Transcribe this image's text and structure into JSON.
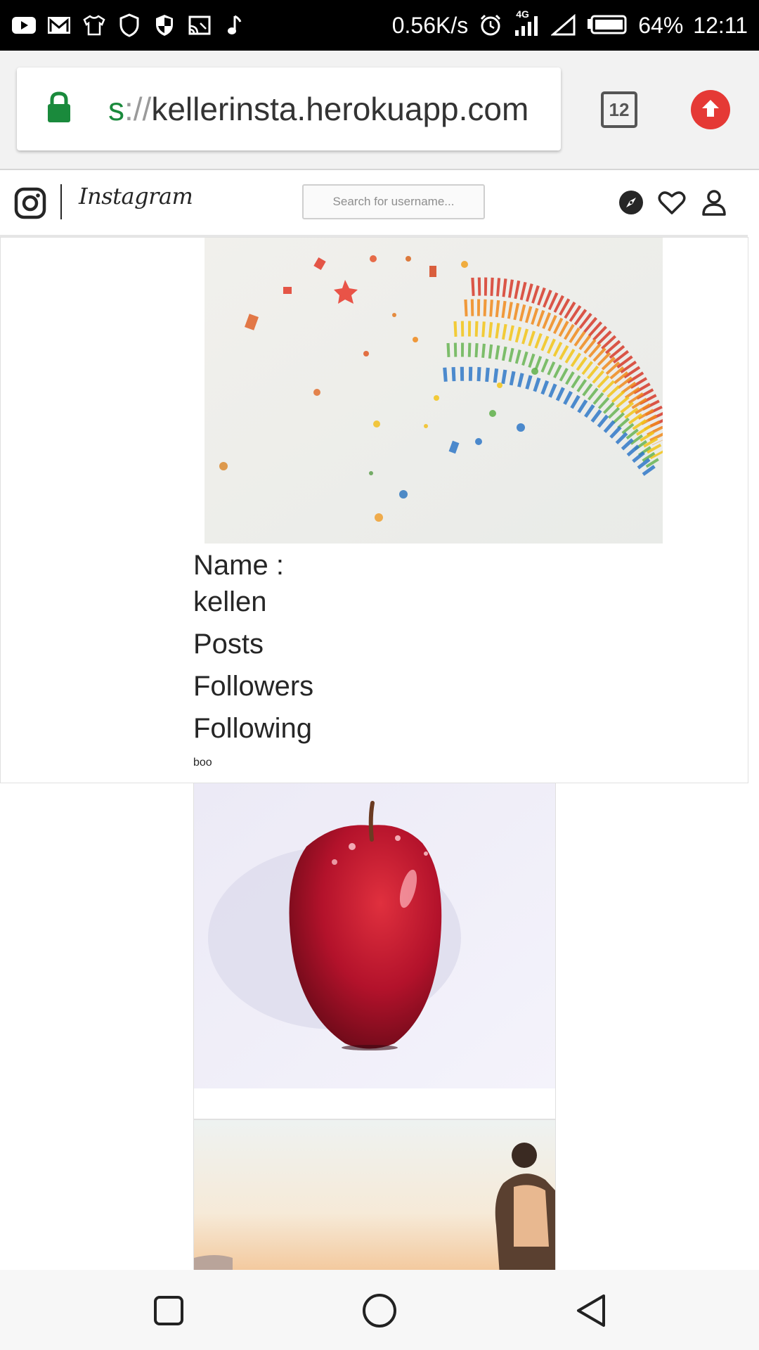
{
  "status_bar": {
    "network_speed": "0.56K/s",
    "network_type": "4G",
    "battery": "64%",
    "time": "12:11",
    "icons": [
      "youtube-icon",
      "gmail-icon",
      "shirt-icon",
      "shield-icon",
      "shield-half-icon",
      "cast-icon",
      "music-note-icon",
      "alarm-icon",
      "signal-icon",
      "signal-empty-icon",
      "battery-icon"
    ]
  },
  "browser": {
    "url_scheme": "s",
    "url_separator": "://",
    "url_host": "kellerinsta.herokuapp.com",
    "tab_count": "12",
    "accent": "#1a8a3c",
    "update_color": "#e53935"
  },
  "nav": {
    "brand": "Instagram",
    "search_placeholder": "Search for username...",
    "icons": [
      "instagram-logo-icon",
      "compass-icon",
      "heart-icon",
      "user-icon"
    ]
  },
  "profile": {
    "name_label": "Name :",
    "name_value": "kellen",
    "posts_label": "Posts",
    "followers_label": "Followers",
    "following_label": "Following",
    "bio": "boo"
  },
  "posts": [
    {
      "image": "red apple photo"
    },
    {
      "image": "man at sunset photo"
    }
  ],
  "system_nav": {
    "icons": [
      "square-recents-icon",
      "circle-home-icon",
      "triangle-back-icon"
    ]
  }
}
